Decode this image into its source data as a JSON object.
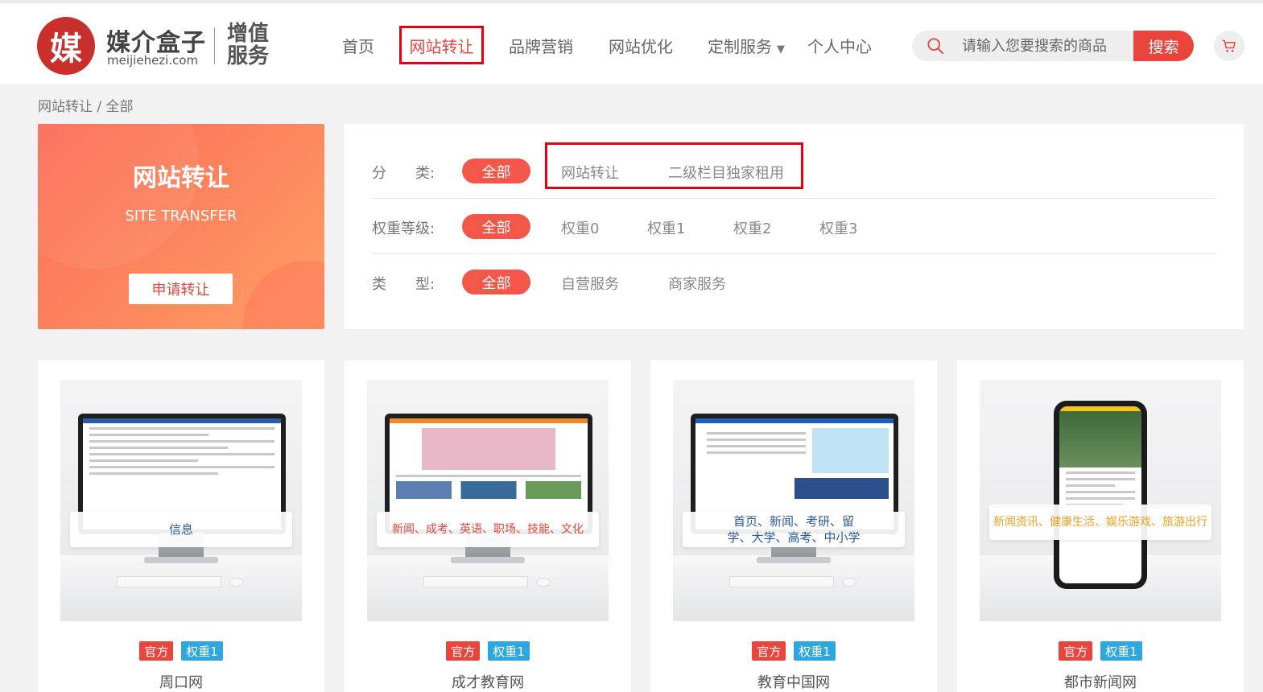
{
  "header": {
    "logo_char": "媒",
    "logo_cn": "媒介盒子",
    "logo_en": "meijiehezi.com",
    "logo_sub": "增值服务",
    "nav": [
      "首页",
      "网站转让",
      "品牌营销",
      "网站优化",
      "定制服务",
      "个人中心"
    ],
    "nav_active_index": 1,
    "dropdown_caret": "▼",
    "search_placeholder": "请输入您要搜索的商品",
    "search_button": "搜索",
    "accent_color": "#e8453c"
  },
  "breadcrumb": "网站转让 / 全部",
  "promo": {
    "title": "网站转让",
    "subtitle": "SITE TRANSFER",
    "button": "申请转让"
  },
  "filters": {
    "category": {
      "label": "分　　类:",
      "selected": "全部",
      "options": [
        "网站转让",
        "二级栏目独家租用"
      ]
    },
    "weight": {
      "label": "权重等级:",
      "selected": "全部",
      "options": [
        "权重0",
        "权重1",
        "权重2",
        "权重3"
      ]
    },
    "type": {
      "label": "类　　型:",
      "selected": "全部",
      "options": [
        "自营服务",
        "商家服务"
      ]
    }
  },
  "products": [
    {
      "name": "周口网",
      "overlay": "信息",
      "overlay_color": "#2b5aa0",
      "badge_official": "官方",
      "badge_weight": "权重1",
      "device": "monitor"
    },
    {
      "name": "成才教育网",
      "overlay": "新闻、成考、英语、职场、技能、文化",
      "overlay_color": "#e8453c",
      "badge_official": "官方",
      "badge_weight": "权重1",
      "device": "monitor"
    },
    {
      "name": "教育中国网",
      "overlay": "首页、新闻、考研、留学、大学、高考、中小学",
      "overlay_color": "#2b5aa0",
      "badge_official": "官方",
      "badge_weight": "权重1",
      "device": "monitor"
    },
    {
      "name": "都市新闻网",
      "overlay": "新闻资讯、健康生活、娱乐游戏、旅游出行",
      "overlay_color": "#f0a020",
      "badge_official": "官方",
      "badge_weight": "权重1",
      "device": "phone"
    }
  ]
}
